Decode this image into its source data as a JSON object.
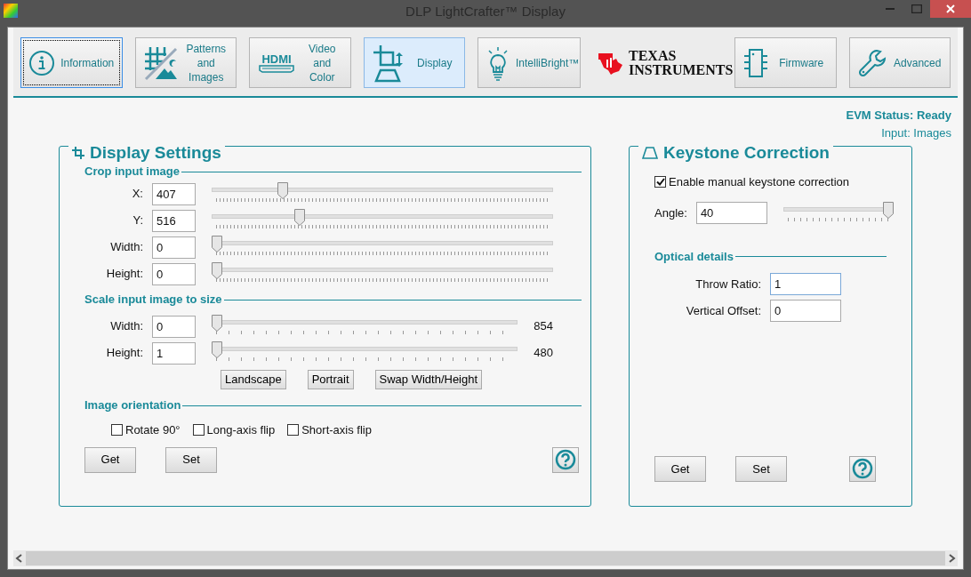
{
  "window": {
    "title": "DLP LightCrafter™ Display"
  },
  "toolbar": [
    {
      "kind": "button",
      "label": "Information",
      "selected": false,
      "focused": true
    },
    {
      "kind": "button",
      "label": "Patterns\nand\nImages",
      "selected": false,
      "focused": false
    },
    {
      "kind": "button",
      "icon_text": "HDMI",
      "label": "Video\nand\nColor",
      "selected": false,
      "focused": false
    },
    {
      "kind": "button",
      "label": "Display",
      "selected": true,
      "focused": false
    },
    {
      "kind": "button",
      "label": "IntelliBright™",
      "selected": false,
      "focused": false
    },
    {
      "kind": "logo",
      "lines": [
        "TEXAS",
        "INSTRUMENTS"
      ]
    },
    {
      "kind": "button",
      "label": "Firmware",
      "selected": false,
      "focused": false
    },
    {
      "kind": "button",
      "label": "Advanced",
      "selected": false,
      "focused": false
    }
  ],
  "status": {
    "evm": "EVM Status: Ready",
    "input": "Input: Images"
  },
  "display_settings": {
    "title": "Display Settings",
    "sections": [
      {
        "title": "Crop input image",
        "kind": "sliders",
        "rows": [
          {
            "label": "X:",
            "value": "407",
            "level": 0.2
          },
          {
            "label": "Y:",
            "value": "516",
            "level": 0.25
          },
          {
            "label": "Width:",
            "value": "0",
            "level": 0
          },
          {
            "label": "Height:",
            "value": "0",
            "level": 0
          }
        ]
      },
      {
        "title": "Scale input image to size",
        "kind": "scale",
        "rows": [
          {
            "label": "Width:",
            "value": "0",
            "level": 0,
            "max": "854"
          },
          {
            "label": "Height:",
            "value": "1",
            "level": 0,
            "max": "480"
          }
        ],
        "buttons": [
          "Landscape",
          "Portrait",
          "Swap Width/Height"
        ]
      },
      {
        "title": "Image orientation",
        "kind": "checks",
        "checks": [
          {
            "label": "Rotate 90°",
            "checked": false
          },
          {
            "label": "Long-axis flip",
            "checked": false
          },
          {
            "label": "Short-axis flip",
            "checked": false
          }
        ]
      }
    ],
    "buttons": [
      "Get",
      "Set"
    ]
  },
  "keystone": {
    "title": "Keystone Correction",
    "enable": {
      "label": "Enable manual keystone correction",
      "checked": true
    },
    "angle": {
      "label": "Angle:",
      "value": "40",
      "level": 1
    },
    "optical": {
      "title": "Optical details",
      "fields": [
        {
          "label": "Throw Ratio:",
          "value": "1",
          "focused": true
        },
        {
          "label": "Vertical Offset:",
          "value": "0",
          "focused": false
        }
      ]
    },
    "buttons": [
      "Get",
      "Set"
    ]
  }
}
